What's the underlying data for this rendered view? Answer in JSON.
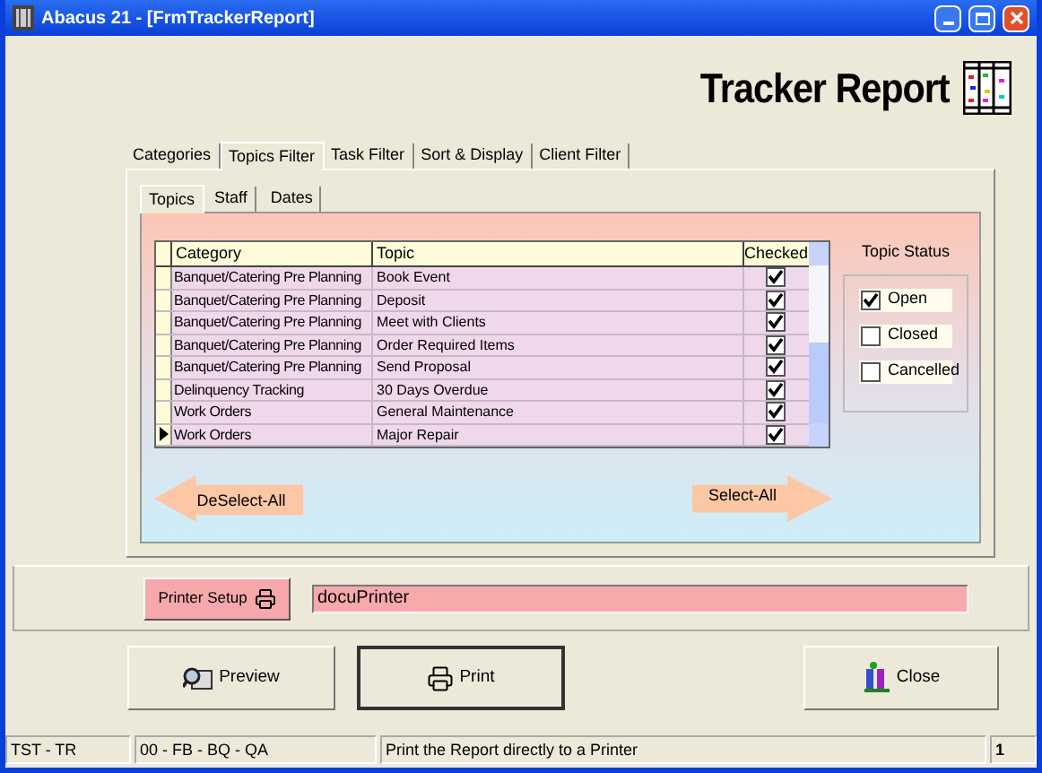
{
  "window": {
    "title": "Abacus 21 - [FrmTrackerReport]"
  },
  "header": {
    "title": "Tracker Report"
  },
  "tabs": [
    {
      "label": "Categories",
      "selected": false
    },
    {
      "label": "Topics Filter",
      "selected": true
    },
    {
      "label": "Task Filter",
      "selected": false
    },
    {
      "label": "Sort & Display",
      "selected": false
    },
    {
      "label": "Client Filter",
      "selected": false
    }
  ],
  "subtabs": [
    {
      "label": "Topics",
      "selected": true
    },
    {
      "label": "Staff",
      "selected": false
    },
    {
      "label": "Dates",
      "selected": false
    }
  ],
  "table": {
    "columns": [
      "Category",
      "Topic",
      "Checked"
    ],
    "rows": [
      {
        "category": "Banquet/Catering Pre Planning",
        "topic": "Book Event",
        "checked": true,
        "selected": false
      },
      {
        "category": "Banquet/Catering Pre Planning",
        "topic": "Deposit",
        "checked": true,
        "selected": false
      },
      {
        "category": "Banquet/Catering Pre Planning",
        "topic": "Meet with Clients",
        "checked": true,
        "selected": false
      },
      {
        "category": "Banquet/Catering Pre Planning",
        "topic": "Order Required Items",
        "checked": true,
        "selected": false
      },
      {
        "category": "Banquet/Catering Pre Planning",
        "topic": "Send Proposal",
        "checked": true,
        "selected": false
      },
      {
        "category": "Delinquency Tracking",
        "topic": "30 Days Overdue",
        "checked": true,
        "selected": false
      },
      {
        "category": "Work Orders",
        "topic": "General Maintenance",
        "checked": true,
        "selected": false
      },
      {
        "category": "Work Orders",
        "topic": "Major Repair",
        "checked": true,
        "selected": true
      }
    ]
  },
  "topic_status": {
    "title": "Topic Status",
    "options": [
      {
        "label": "Open",
        "checked": true
      },
      {
        "label": "Closed",
        "checked": false
      },
      {
        "label": "Cancelled",
        "checked": false
      }
    ]
  },
  "deselect_all": "DeSelect-All",
  "select_all": "Select-All",
  "printer_setup": "Printer Setup",
  "printer": "docuPrinter",
  "buttons": [
    {
      "label": "Preview",
      "kind": "preview"
    },
    {
      "label": "Print",
      "kind": "print"
    },
    {
      "label": "Close",
      "kind": "close"
    }
  ],
  "status_bar": [
    "TST - TR",
    "00 - FB - BQ - QA",
    "Print the Report directly to a Printer",
    "1"
  ]
}
